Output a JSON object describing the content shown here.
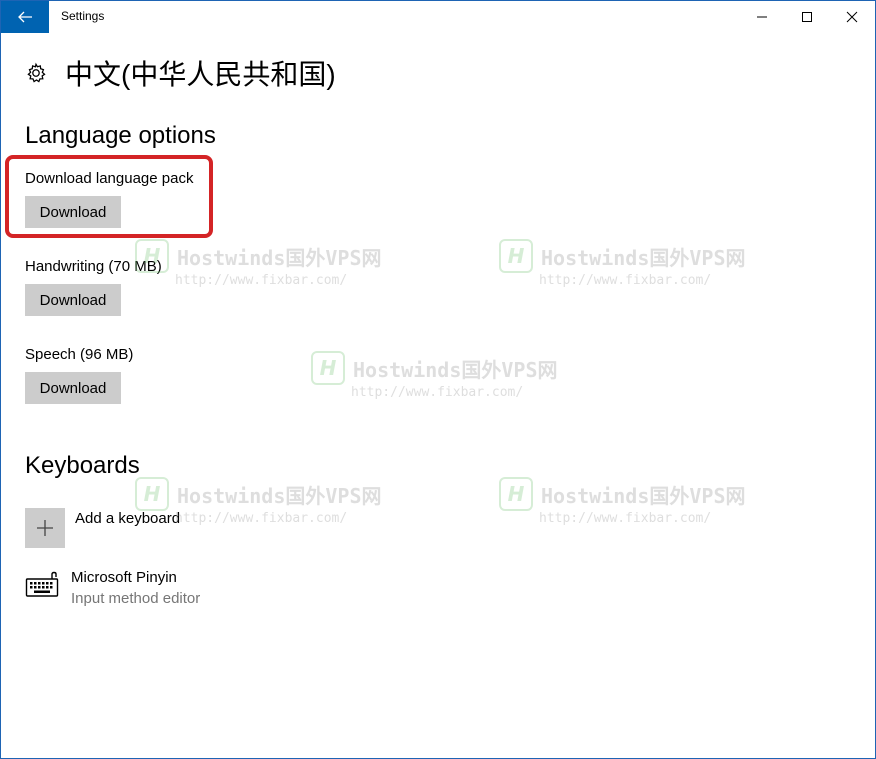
{
  "window": {
    "title": "Settings",
    "accent": "#0063b1"
  },
  "icons": {
    "back": "arrow-left-icon",
    "minimize": "minimize-icon",
    "maximize": "maximize-icon",
    "close": "close-icon",
    "settings": "gear-icon",
    "add": "plus-icon",
    "keyboard": "keyboard-icon"
  },
  "page": {
    "title": "中文(中华人民共和国)"
  },
  "language_options": {
    "heading": "Language options",
    "items": [
      {
        "label": "Download language pack",
        "button": "Download"
      },
      {
        "label": "Handwriting (70 MB)",
        "button": "Download"
      },
      {
        "label": "Speech (96 MB)",
        "button": "Download"
      }
    ],
    "highlight_color": "#d42426"
  },
  "keyboards": {
    "heading": "Keyboards",
    "add_label": "Add a keyboard",
    "items": [
      {
        "name": "Microsoft Pinyin",
        "description": "Input method editor"
      }
    ]
  },
  "watermark": {
    "logo": "H",
    "text": "Hostwinds国外VPS网",
    "url": "http://www.fixbar.com/"
  }
}
